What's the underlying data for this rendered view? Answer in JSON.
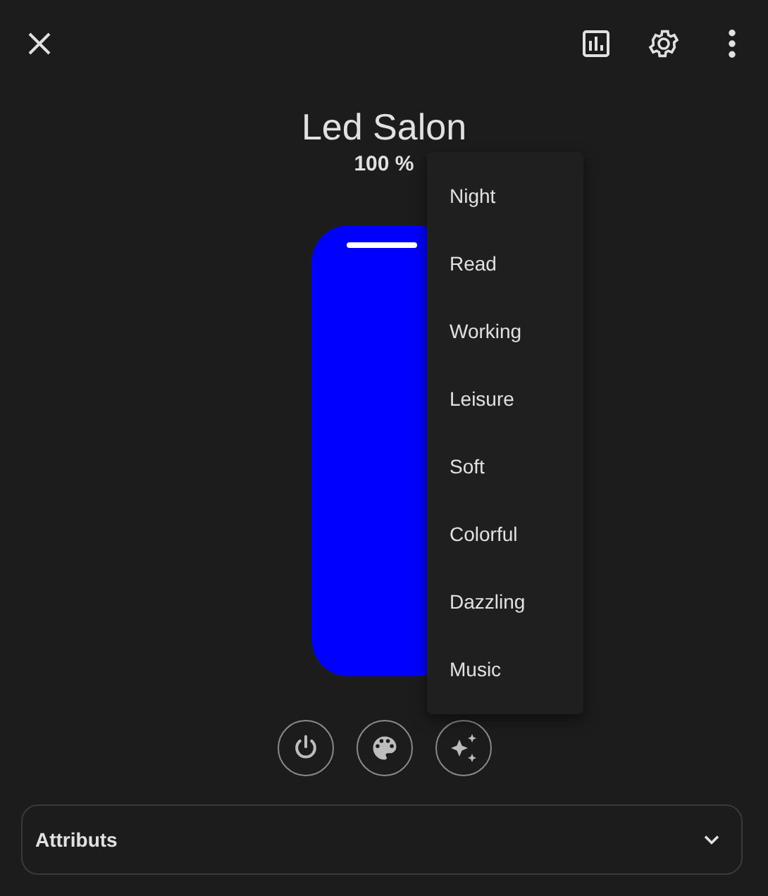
{
  "title": "Led Salon",
  "brightness": {
    "reading": "100 %",
    "level": 1.0,
    "color": "#0000ff"
  },
  "effect_menu": {
    "items": [
      {
        "label": "Night"
      },
      {
        "label": "Read"
      },
      {
        "label": "Working"
      },
      {
        "label": "Leisure"
      },
      {
        "label": "Soft"
      },
      {
        "label": "Colorful"
      },
      {
        "label": "Dazzling"
      },
      {
        "label": "Music"
      }
    ]
  },
  "attributes": {
    "label": "Attributs",
    "expanded": false
  }
}
